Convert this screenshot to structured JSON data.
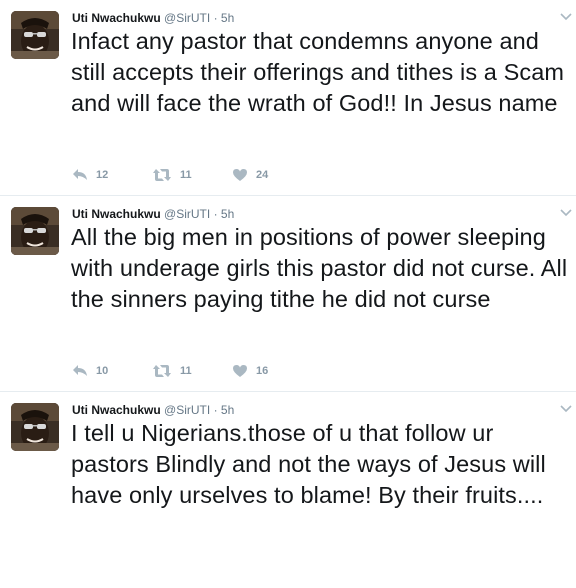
{
  "tweets": [
    {
      "author": {
        "name": "Uti Nwachukwu",
        "handle": "@SirUTI"
      },
      "separator": "·",
      "time": "5h",
      "text": "Infact any pastor that condemns anyone and still accepts their offerings and tithes is a Scam and will face the wrath of God!! In Jesus name",
      "counts": {
        "replies": "12",
        "retweets": "11",
        "likes": "24"
      }
    },
    {
      "author": {
        "name": "Uti Nwachukwu",
        "handle": "@SirUTI"
      },
      "separator": "·",
      "time": "5h",
      "text": "All the big men in positions of power sleeping with underage girls this pastor did not curse. All the sinners paying tithe he did not curse",
      "counts": {
        "replies": "10",
        "retweets": "11",
        "likes": "16"
      }
    },
    {
      "author": {
        "name": "Uti Nwachukwu",
        "handle": "@SirUTI"
      },
      "separator": "·",
      "time": "5h",
      "text": "I tell u Nigerians.those of u that follow ur pastors Blindly and not the ways of Jesus will have only urselves to blame! By their fruits....",
      "counts": {
        "replies": "",
        "retweets": "",
        "likes": ""
      }
    }
  ],
  "icons": {
    "avatar": "profile-photo",
    "menu": "chevron-down-icon",
    "reply": "reply-icon",
    "retweet": "retweet-icon",
    "like": "heart-icon"
  },
  "colors": {
    "text": "#14171a",
    "muted": "#657786",
    "action_icon": "#aab8c2",
    "divider": "#e6ecf0"
  }
}
